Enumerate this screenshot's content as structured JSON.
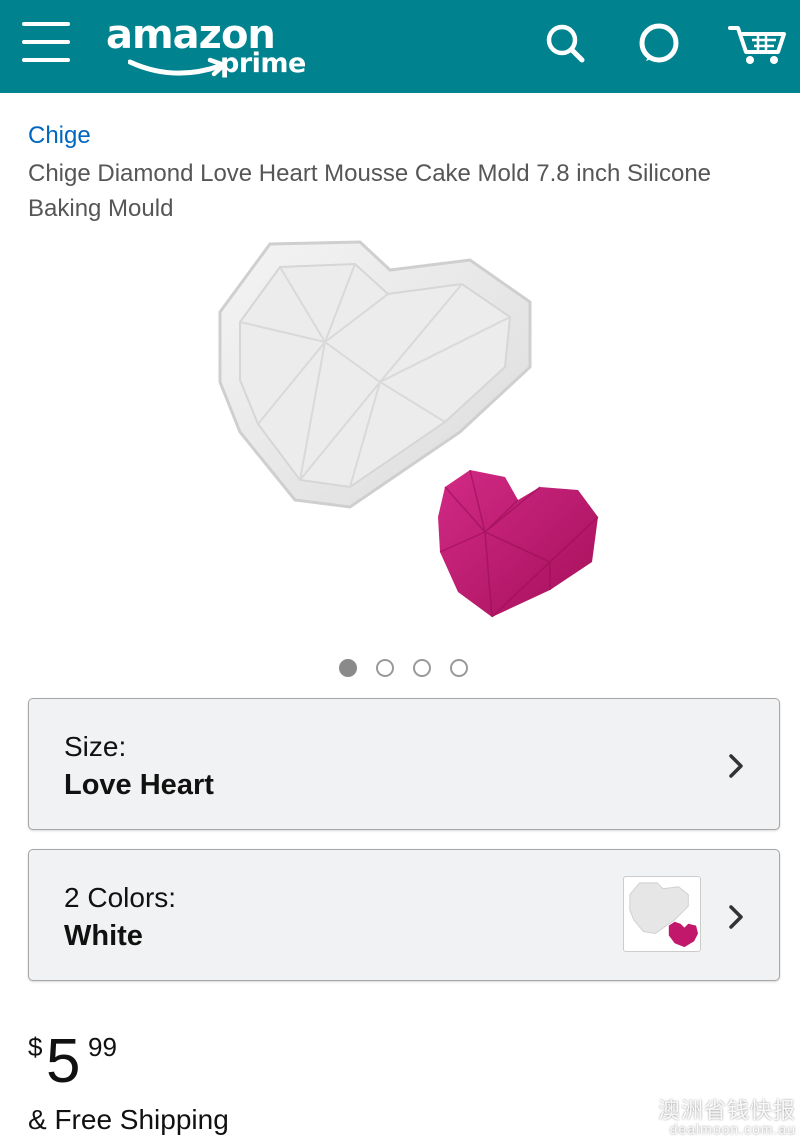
{
  "header": {
    "logo_word": "amazon",
    "logo_sub": "prime",
    "icons": [
      "menu-icon",
      "search-icon",
      "alexa-icon",
      "cart-icon"
    ],
    "brand_color": "#00838F"
  },
  "product": {
    "brand": "Chige",
    "title": "Chige Diamond Love Heart Mousse Cake Mold 7.8 inch Silicone Baking Mould",
    "image_count": 4,
    "active_image": 1
  },
  "size_selector": {
    "label": "Size:",
    "value": "Love Heart"
  },
  "color_selector": {
    "label": "2 Colors:",
    "value": "White"
  },
  "price": {
    "currency": "$",
    "whole": "5",
    "fraction": "99"
  },
  "shipping": "& Free Shipping",
  "watermark": {
    "cn": "澳洲省钱快报",
    "en": "dealmoon.com.au"
  },
  "colors": {
    "link": "#0066C0",
    "heart_pink": "#C2186B"
  }
}
